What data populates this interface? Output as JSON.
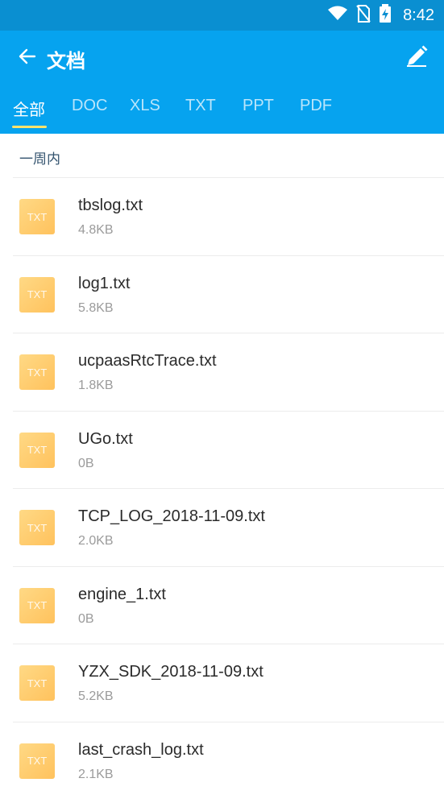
{
  "status_bar": {
    "time": "8:42",
    "icons": [
      "wifi-icon",
      "no-sim-icon",
      "battery-charging-icon"
    ]
  },
  "header": {
    "title": "文档",
    "back_icon": "arrow-left-icon",
    "edit_icon": "pencil-icon"
  },
  "tabs": [
    {
      "label": "全部",
      "active": true
    },
    {
      "label": "DOC",
      "active": false
    },
    {
      "label": "XLS",
      "active": false
    },
    {
      "label": "TXT",
      "active": false
    },
    {
      "label": "PPT",
      "active": false
    },
    {
      "label": "PDF",
      "active": false
    }
  ],
  "section": {
    "title": "一周内"
  },
  "files": [
    {
      "icon_label": "TXT",
      "name": "tbslog.txt",
      "size": "4.8KB"
    },
    {
      "icon_label": "TXT",
      "name": "log1.txt",
      "size": "5.8KB"
    },
    {
      "icon_label": "TXT",
      "name": "ucpaasRtcTrace.txt",
      "size": "1.8KB"
    },
    {
      "icon_label": "TXT",
      "name": "UGo.txt",
      "size": "0B"
    },
    {
      "icon_label": "TXT",
      "name": "TCP_LOG_2018-11-09.txt",
      "size": "2.0KB"
    },
    {
      "icon_label": "TXT",
      "name": "engine_1.txt",
      "size": "0B"
    },
    {
      "icon_label": "TXT",
      "name": "YZX_SDK_2018-11-09.txt",
      "size": "5.2KB"
    },
    {
      "icon_label": "TXT",
      "name": "last_crash_log.txt",
      "size": "2.1KB"
    }
  ],
  "colors": {
    "status_bar": "#0a8fd1",
    "app_bar": "#06a3ef",
    "tab_indicator": "#ffe36c",
    "file_icon": "#ffc96a"
  }
}
